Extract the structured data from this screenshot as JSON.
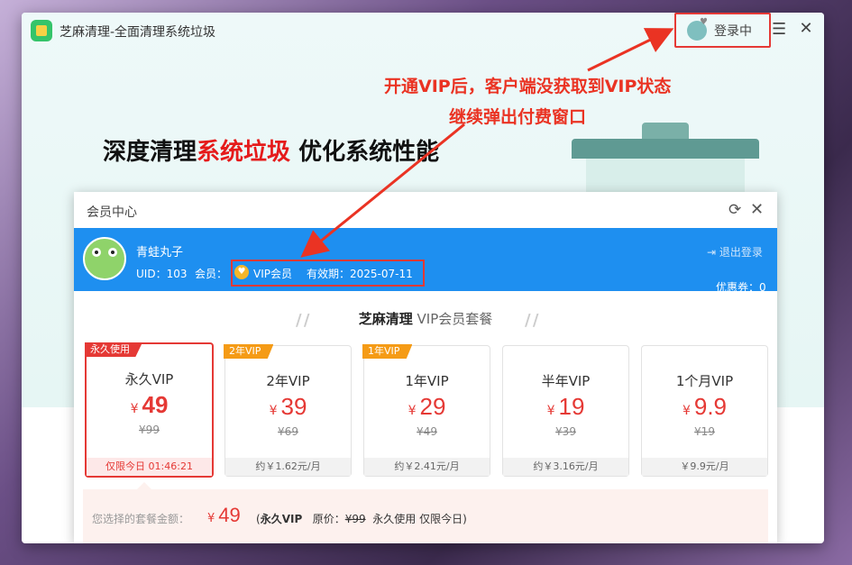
{
  "app": {
    "title": "芝麻清理-全面清理系统垃圾",
    "login_label": "登录中"
  },
  "annotations": {
    "line1": "开通VIP后，客户端没获取到VIP状态",
    "line2": "继续弹出付费窗口"
  },
  "headline": {
    "part1": "深度清理",
    "part2": "系统垃圾",
    "part3": " 优化系统性能"
  },
  "dialog": {
    "title": "会员中心",
    "user": {
      "name": "青蛙丸子",
      "uid": "UID：103",
      "member_label": "会员：",
      "vip_status": "VIP会员",
      "expiry": "有效期：2025-07-11",
      "logout": "退出登录",
      "coupon": "优惠券：0"
    },
    "section": {
      "brand": "芝麻清理",
      "suffix": " VIP会员套餐"
    },
    "plans": [
      {
        "tag": "永久使用",
        "name": "永久VIP",
        "currency": "¥",
        "price": "49",
        "original": "¥99",
        "footer": "仅限今日 01:46:21"
      },
      {
        "tag": "2年VIP",
        "name": "2年VIP",
        "currency": "¥",
        "price": "39",
        "original": "¥69",
        "footer": "约￥1.62元/月"
      },
      {
        "tag": "1年VIP",
        "name": "1年VIP",
        "currency": "¥",
        "price": "29",
        "original": "¥49",
        "footer": "约￥2.41元/月"
      },
      {
        "tag": "",
        "name": "半年VIP",
        "currency": "¥",
        "price": "19",
        "original": "¥39",
        "footer": "约￥3.16元/月"
      },
      {
        "tag": "",
        "name": "1个月VIP",
        "currency": "¥",
        "price": "9.9",
        "original": "¥19",
        "footer": "￥9.9元/月"
      }
    ],
    "summary": {
      "label": "您选择的套餐金额：",
      "currency": "¥",
      "price": "49",
      "plan": "永久VIP",
      "orig_label": "原价：",
      "orig_price": "¥99",
      "note": "永久使用  仅限今日)"
    }
  },
  "colors": {
    "accent_red": "#e53935",
    "header_blue": "#1e8ff0",
    "tag_orange": "#f59b16"
  }
}
